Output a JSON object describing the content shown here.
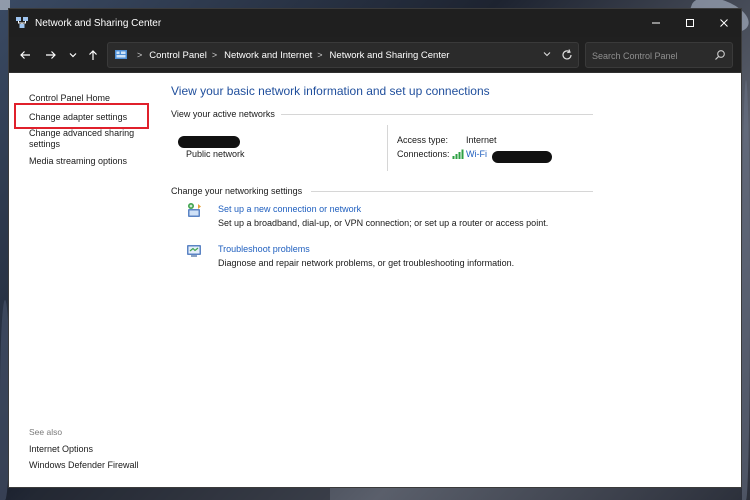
{
  "window": {
    "title": "Network and Sharing Center",
    "icons": {
      "app": "network-center-icon",
      "minimize": "minimize-icon",
      "maximize": "maximize-icon",
      "close": "close-icon"
    }
  },
  "nav": {
    "back_icon": "back-arrow-icon",
    "forward_icon": "forward-arrow-icon",
    "recent_icon": "chevron-down-icon",
    "up_icon": "up-arrow-icon",
    "breadcrumbs": [
      "Control Panel",
      "Network and Internet",
      "Network and Sharing Center"
    ],
    "search_placeholder": "Search Control Panel"
  },
  "sidebar": {
    "home": "Control Panel Home",
    "adapter": "Change adapter settings",
    "advanced": "Change advanced sharing settings",
    "media": "Media streaming options",
    "see_also": "See also",
    "internet_options": "Internet Options",
    "firewall": "Windows Defender Firewall"
  },
  "main": {
    "heading": "View your basic network information and set up connections",
    "active_networks_title": "View your active networks",
    "network_type": "Public network",
    "access_type_label": "Access type:",
    "access_type_value": "Internet",
    "connections_label": "Connections:",
    "connection_value": "Wi-Fi",
    "change_settings_title": "Change your networking settings",
    "tasks": [
      {
        "title": "Set up a new connection or network",
        "desc": "Set up a broadband, dial-up, or VPN connection; or set up a router or access point.",
        "icon": "new-connection-icon"
      },
      {
        "title": "Troubleshoot problems",
        "desc": "Diagnose and repair network problems, or get troubleshooting information.",
        "icon": "troubleshoot-icon"
      }
    ]
  },
  "colors": {
    "link": "#1f5fbf",
    "heading": "#1f4e9c",
    "highlight": "#e0202b",
    "titlebar": "#1f1f1f"
  }
}
